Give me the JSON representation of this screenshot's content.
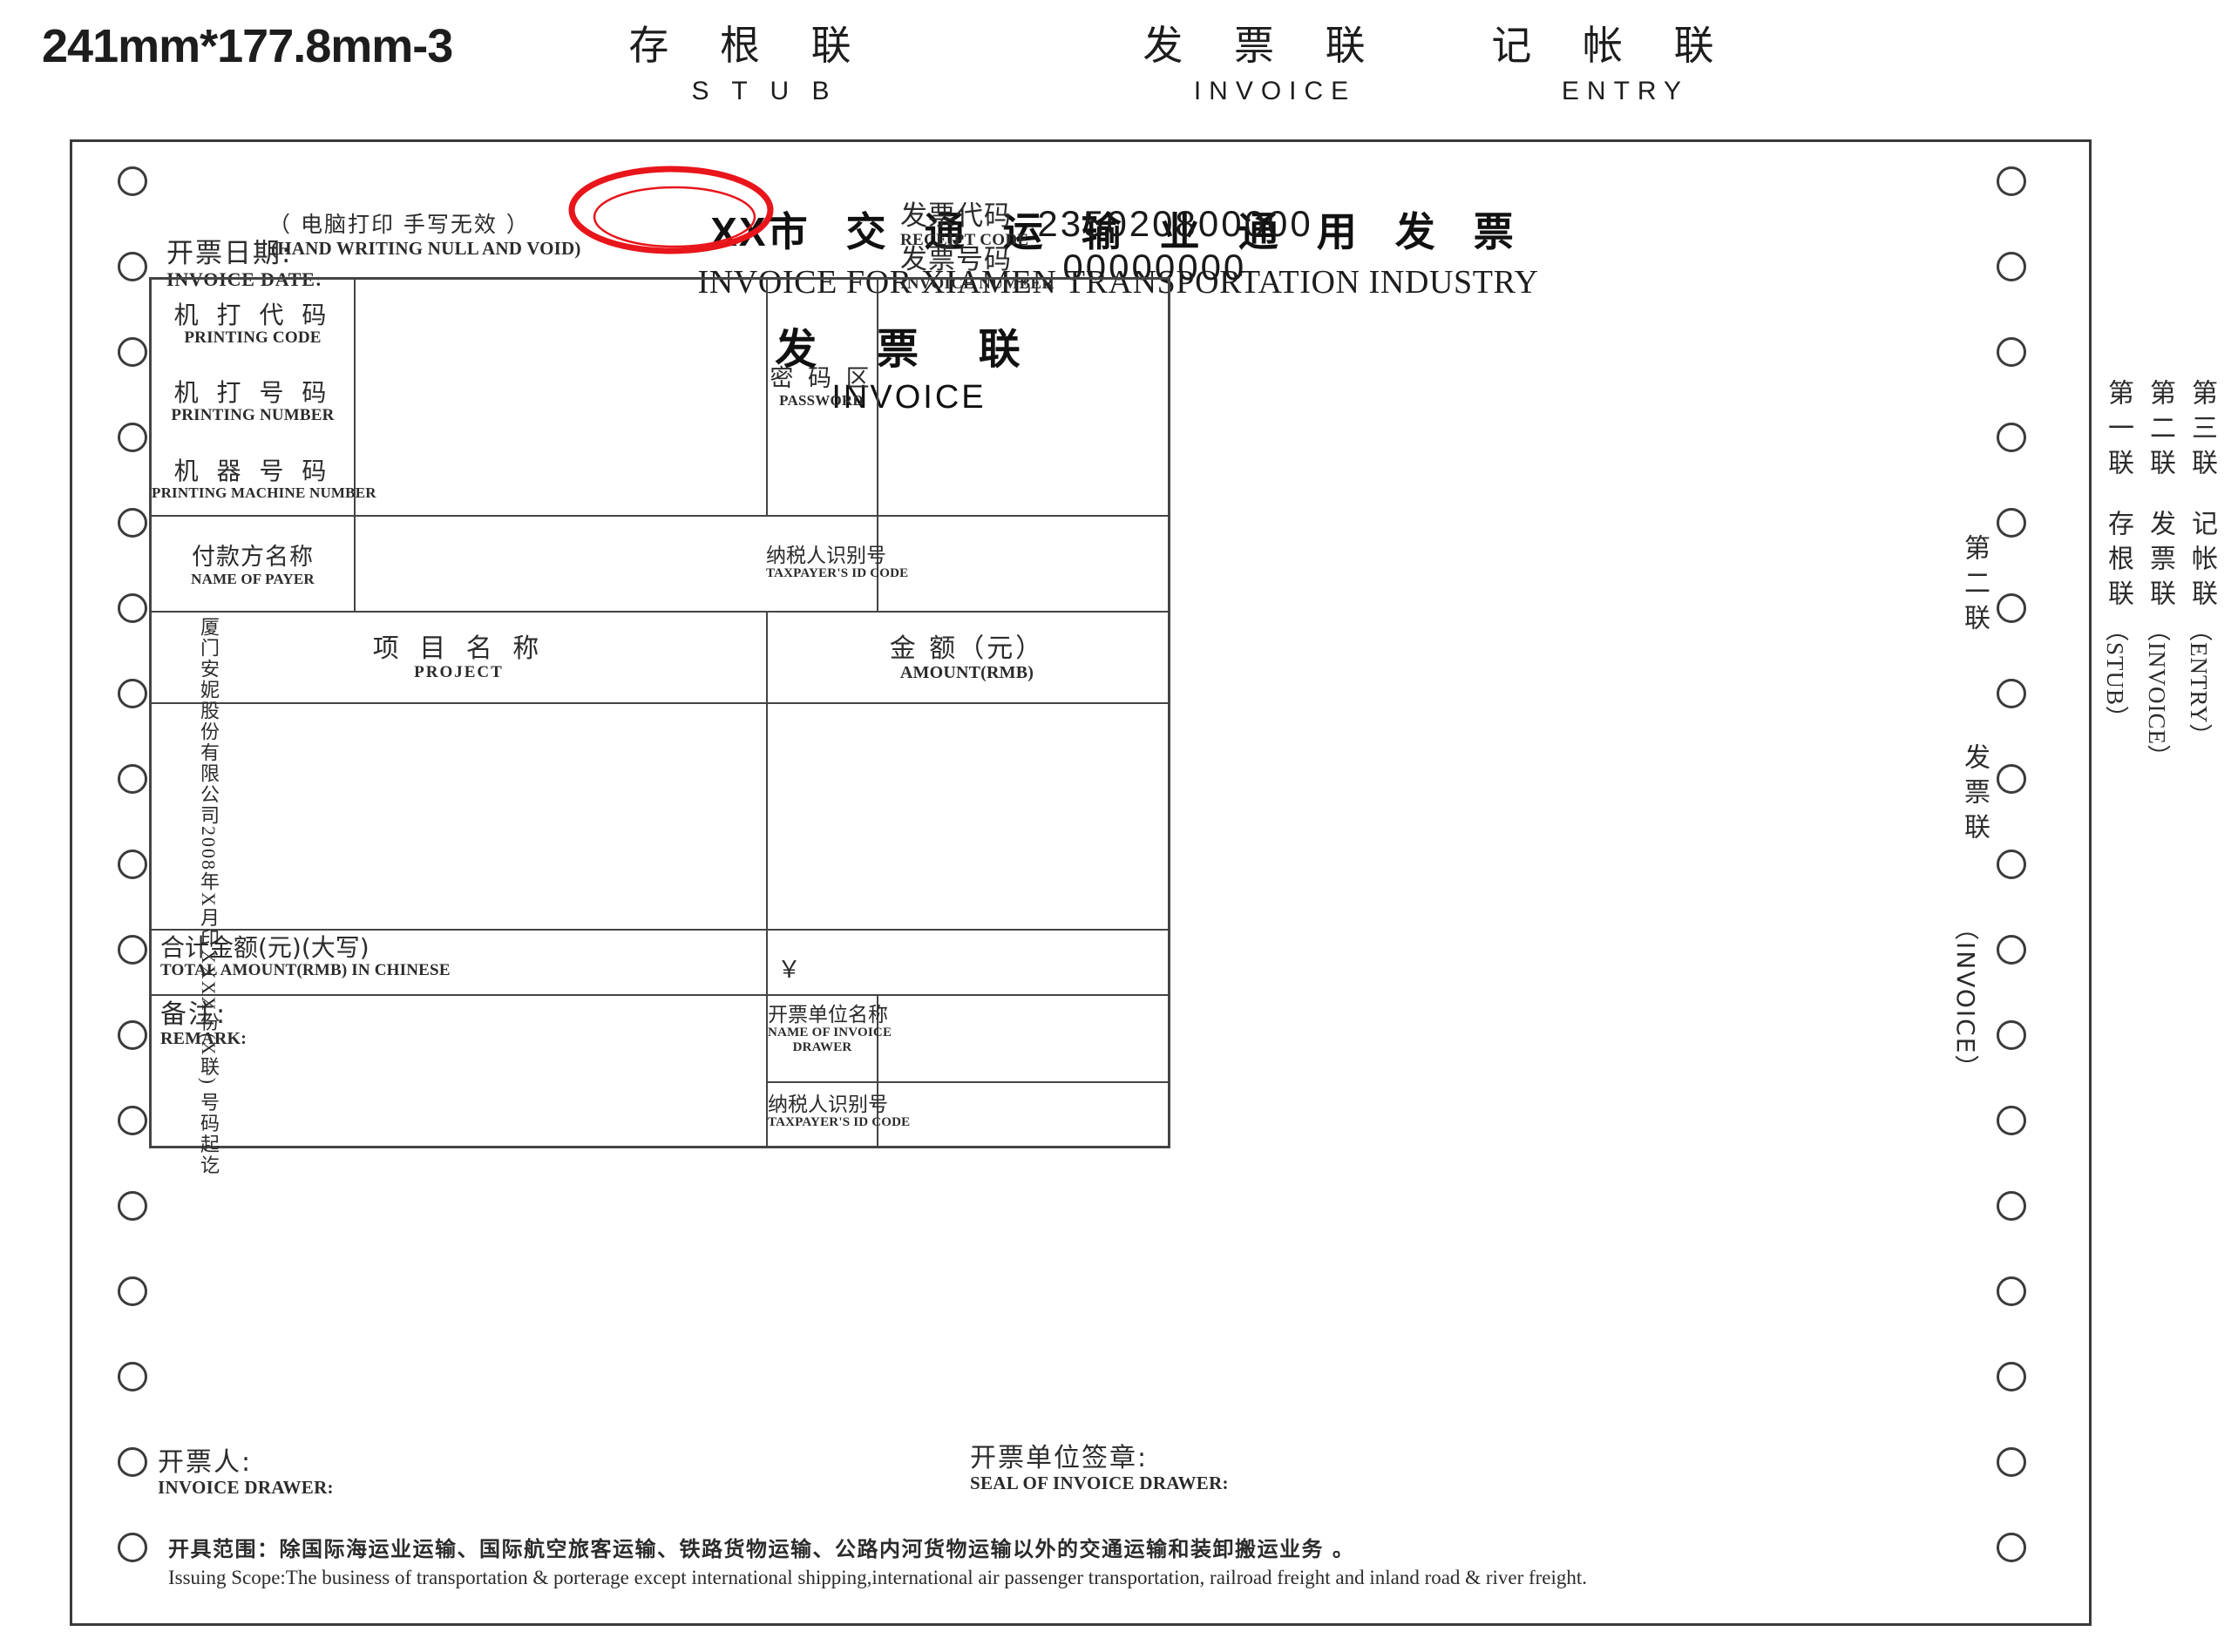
{
  "header": {
    "size_label": "241mm*177.8mm-3",
    "copies": [
      {
        "cn": "存 根 联",
        "en": "S T U B"
      },
      {
        "cn": "发 票 联",
        "en": "INVOICE"
      },
      {
        "cn": "记 帐 联",
        "en": "ENTRY"
      }
    ]
  },
  "form": {
    "hand_note_cn": "（ 电脑打印  手写无效 ）",
    "hand_note_en": "(HAND WRITING NULL AND VOID)",
    "title_prefix": "XX",
    "title_cn": "市 交 通 运 输 业 通 用 发 票",
    "title_en": "INVOICE FOR XIAMEN TRANSPORTATION INDUSTRY",
    "subtitle_cn": "发 票 联",
    "subtitle_en": "INVOICE",
    "receipt_code": {
      "cn": "发票代码",
      "en": "RECEIPT CODE",
      "value": "235020800000"
    },
    "invoice_number": {
      "cn": "发票号码",
      "en": "INVOICE NUMBER",
      "value": "00000000"
    },
    "invoice_date": {
      "cn": "开票日期:",
      "en": "INVOICE  DATE:",
      "value": ""
    },
    "fields": {
      "printing_code": {
        "cn": "机 打 代 码",
        "en": "PRINTING  CODE",
        "value": ""
      },
      "printing_number": {
        "cn": "机 打 号 码",
        "en": "PRINTING NUMBER",
        "value": ""
      },
      "machine_number": {
        "cn": "机 器 号 码",
        "en": "PRINTING  MACHINE  NUMBER",
        "value": ""
      },
      "password": {
        "cn": "密 码 区",
        "en": "PASSWORD",
        "value": ""
      },
      "name_of_payer": {
        "cn": "付款方名称",
        "en": "NAME OF PAYER",
        "value": ""
      },
      "payer_tax_id": {
        "cn": "纳税人识别号",
        "en": "TAXPAYER'S ID CODE",
        "value": ""
      },
      "project": {
        "cn": "项 目 名 称",
        "en": "PROJECT",
        "value": ""
      },
      "amount": {
        "cn": "金    额（元）",
        "en": "AMOUNT(RMB)",
        "value": ""
      },
      "total_in_chinese": {
        "cn": "合计金额(元)(大写)",
        "en": "TOTAL AMOUNT(RMB) IN CHINESE",
        "value": ""
      },
      "total_symbol": "￥",
      "total_value": "",
      "remark": {
        "cn": "备注:",
        "en": "REMARK:",
        "value": ""
      },
      "drawer_name": {
        "cn": "开票单位名称",
        "en_line1": "NAME OF INVOICE",
        "en_line2": "DRAWER",
        "value": ""
      },
      "drawer_tax_id": {
        "cn": "纳税人识别号",
        "en": "TAXPAYER'S ID CODE",
        "value": ""
      }
    },
    "footer": {
      "invoice_drawer": {
        "cn": "开票人:",
        "en": "INVOICE DRAWER:"
      },
      "seal_of_drawer": {
        "cn": "开票单位签章:",
        "en": "SEAL OF INVOICE DRAWER:"
      },
      "scope_cn": "开具范围：除国际海运业运输、国际航空旅客运输、铁路货物运输、公路内河货物运输以外的交通运输和装卸搬运业务 。",
      "scope_en": "Issuing Scope:The business of transportation & porterage except international shipping,international air passenger transportation, railroad freight and inland road & river freight."
    },
    "vertical_left": "厦门安妮股份有限公司2008年X月印XXXX份(X联) 号码起讫",
    "vertical_inner": {
      "line1": "第二联",
      "line2": "发票联",
      "line3": "（INVOICE）"
    },
    "vertical_outer": [
      {
        "no": "第一联",
        "name": "存根联",
        "en": "（STUB）"
      },
      {
        "no": "第二联",
        "name": "发票联",
        "en": "（INVOICE）"
      },
      {
        "no": "第三联",
        "name": "记帐联",
        "en": "（ENTRY）"
      }
    ]
  },
  "colors": {
    "annotation_red": "#e8151b",
    "ink": "#2b2b2b"
  }
}
